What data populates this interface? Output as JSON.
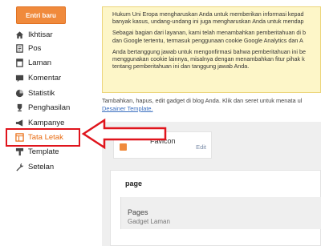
{
  "sidebar": {
    "new_entry": "Entri baru",
    "items": [
      {
        "label": "Ikhtisar",
        "icon": "home-icon"
      },
      {
        "label": "Pos",
        "icon": "document-icon"
      },
      {
        "label": "Laman",
        "icon": "page-icon"
      },
      {
        "label": "Komentar",
        "icon": "comment-icon"
      },
      {
        "label": "Statistik",
        "icon": "stats-icon"
      },
      {
        "label": "Penghasilan",
        "icon": "trophy-icon"
      },
      {
        "label": "Kampanye",
        "icon": "megaphone-icon"
      },
      {
        "label": "Tata Letak",
        "icon": "layout-icon",
        "active": true
      },
      {
        "label": "Template",
        "icon": "template-icon"
      },
      {
        "label": "Setelan",
        "icon": "wrench-icon"
      }
    ]
  },
  "notice": {
    "p1_line1": "Hukum Uni Eropa mengharuskan Anda untuk memberikan informasi kepad",
    "p1_line2": "banyak kasus, undang-undang ini juga mengharuskan Anda untuk mendap",
    "p2_line1": "Sebagai bagian dari layanan, kami telah menambahkan pemberitahuan di b",
    "p2_line2": "dan Google tertentu, termasuk penggunaan cookie Google Analytics dan A",
    "p3_line1": "Anda bertanggung jawab untuk mengonfirmasi bahwa pemberitahuan ini be",
    "p3_line2": "menggunakan cookie lainnya, misalnya dengan menambahkan fitur pihak k",
    "p3_line3": "tentang pemberitahuan ini dan tanggung jawab Anda."
  },
  "description": {
    "text": "Tambahkan, hapus, edit gadget di blog Anda. Klik dan seret untuk menata ul",
    "link": "Desainer Template."
  },
  "favicon_widget": {
    "label": "Favicon",
    "edit": "Edit"
  },
  "page_section": {
    "title": "page",
    "gadget_name": "Pages",
    "gadget_type": "Gadget Laman"
  },
  "colors": {
    "accent": "#f08a3c",
    "highlight": "#e0141c",
    "notice_bg": "#fdf6c8",
    "link": "#3b6fbf"
  }
}
